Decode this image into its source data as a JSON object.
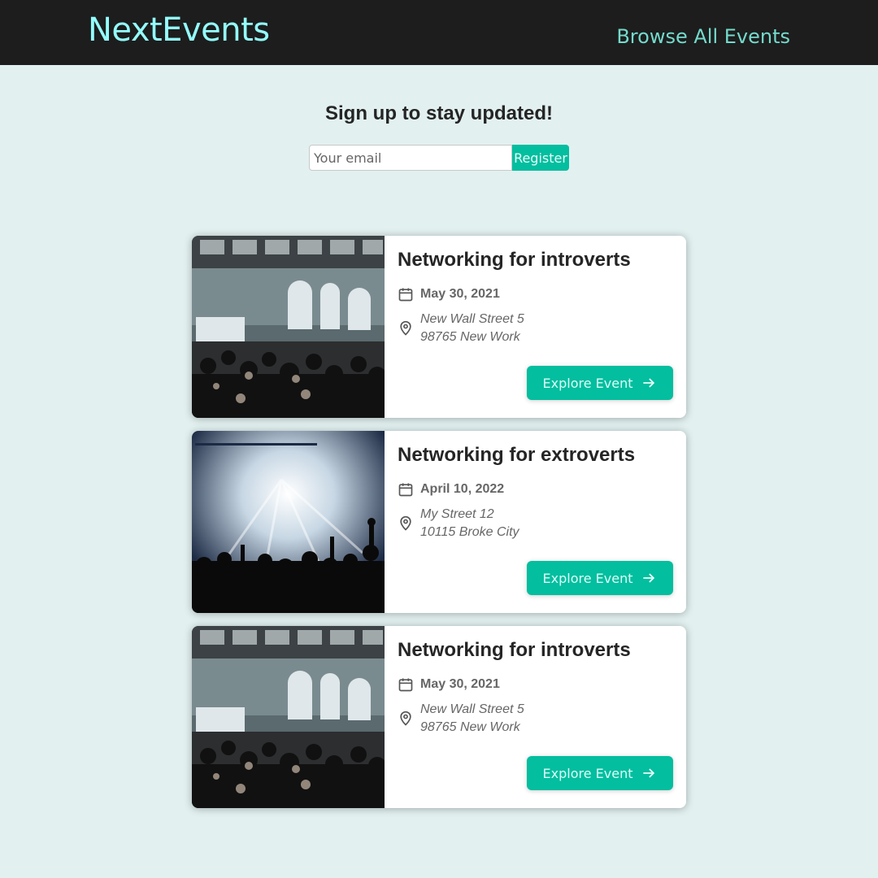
{
  "header": {
    "logo": "NextEvents",
    "nav_link": "Browse All Events"
  },
  "signup": {
    "title": "Sign up to stay updated!",
    "email_placeholder": "Your email",
    "register_label": "Register"
  },
  "events": [
    {
      "title": "Networking for introverts",
      "date": "May 30, 2021",
      "address_line1": "New Wall Street 5",
      "address_line2": "98765 New Work",
      "button_label": "Explore Event",
      "image": "conference-hall-photo"
    },
    {
      "title": "Networking for extroverts",
      "date": "April 10, 2022",
      "address_line1": "My Street 12",
      "address_line2": "10115 Broke City",
      "button_label": "Explore Event",
      "image": "concert-crowd-photo"
    },
    {
      "title": "Networking for introverts",
      "date": "May 30, 2021",
      "address_line1": "New Wall Street 5",
      "address_line2": "98765 New Work",
      "button_label": "Explore Event",
      "image": "conference-hall-photo"
    }
  ],
  "icons": {
    "date": "calendar-icon",
    "address": "map-pin-icon",
    "button": "arrow-right-icon"
  },
  "colors": {
    "header_bg": "#1d1d1d",
    "logo": "#94fdfd",
    "nav_link": "#74dacc",
    "accent": "#03be9f",
    "page_bg": "#e2f0f0"
  }
}
